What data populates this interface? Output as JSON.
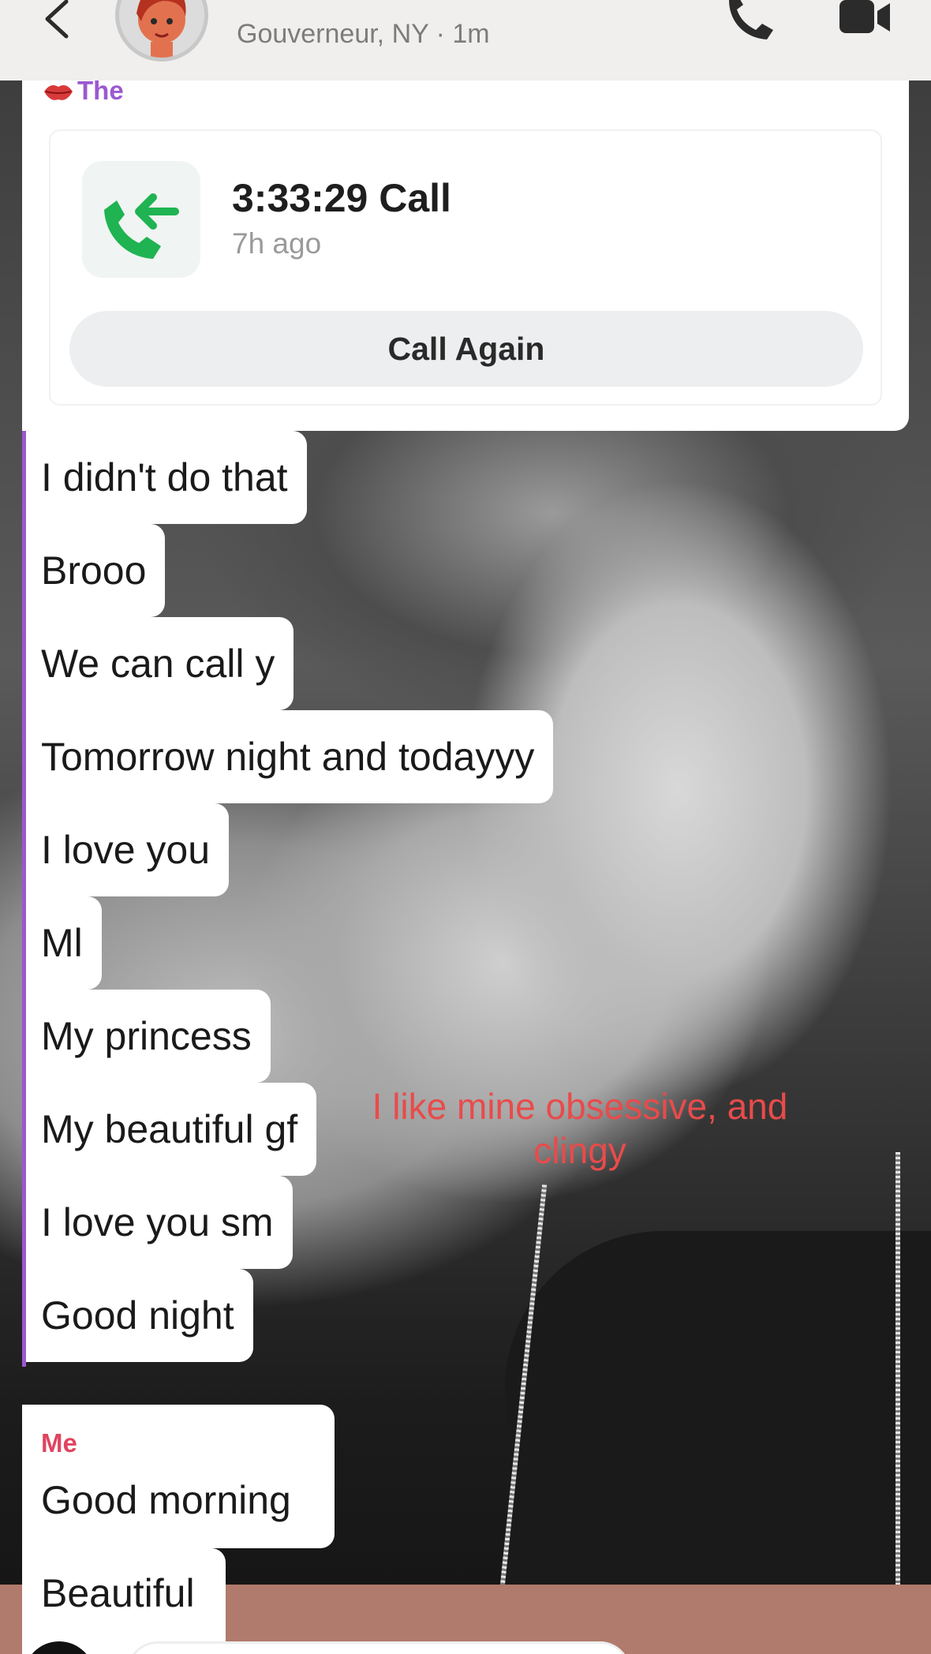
{
  "header": {
    "location": "Gouverneur, NY · 1m",
    "icons": {
      "back": "chevron-left-icon",
      "phone": "phone-icon",
      "video": "video-camera-icon",
      "avatar": "bitmoji-avatar"
    }
  },
  "call_card": {
    "sender": "The",
    "sender_icon": "kiss-lips-icon",
    "title": "3:33:29 Call",
    "time": "7h ago",
    "button_label": "Call Again",
    "icon": "incoming-call-icon",
    "accent": "#9b59d0",
    "call_icon_color": "#1fb352"
  },
  "messages": [
    "I didn't do that",
    "Brooo",
    "We can call y",
    "Tomorrow night and todayyy",
    "I love you",
    "Ml",
    "My princess",
    "My beautiful gf",
    "I love you sm",
    "Good night"
  ],
  "me": {
    "label": "Me",
    "label_color": "#e0445f",
    "messages": [
      "Good morning",
      "Beautiful"
    ]
  },
  "overlay_caption": "I like mine obsessive, and clingy"
}
